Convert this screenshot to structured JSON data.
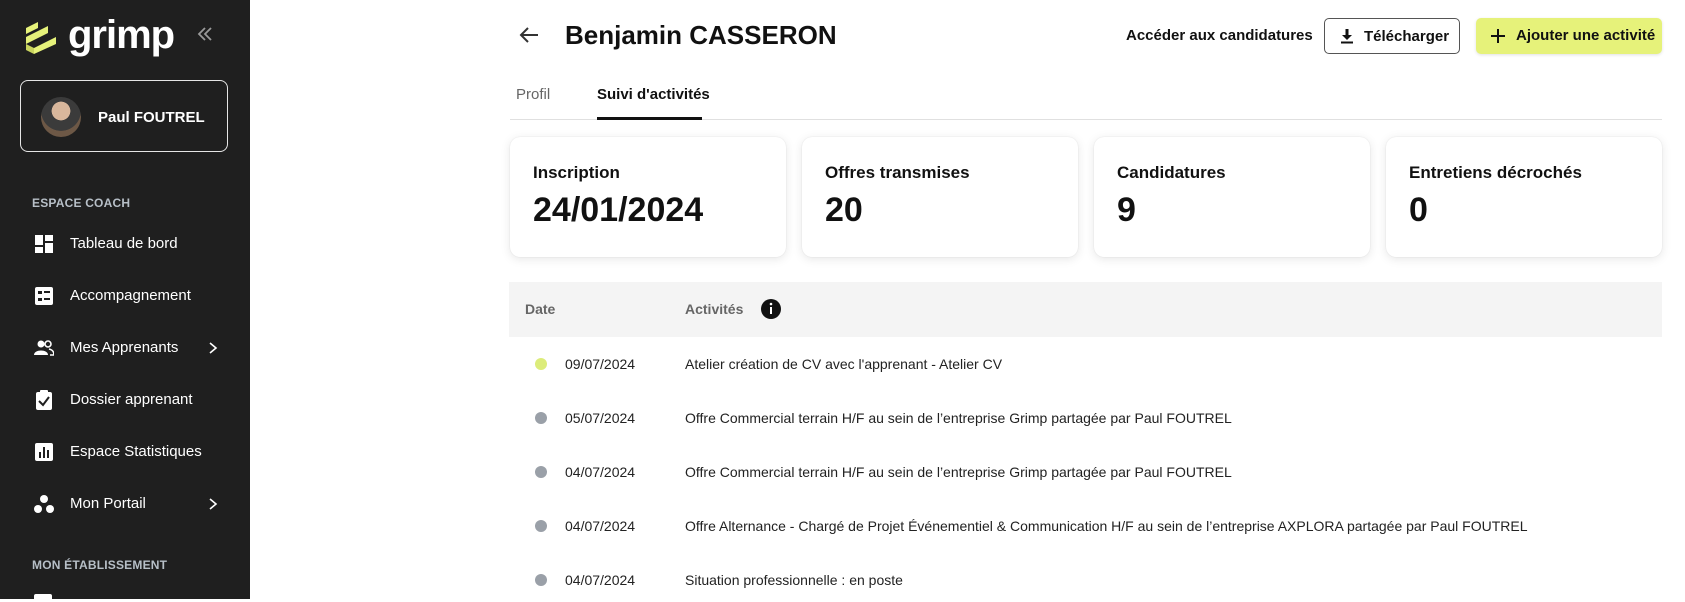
{
  "brand": {
    "name": "grimp",
    "accent": "#e6f27a",
    "sidebar_bg": "#1f1f1f"
  },
  "sidebar": {
    "user_name": "Paul FOUTREL",
    "section_coach": "ESPACE COACH",
    "items": [
      {
        "label": "Tableau de bord",
        "icon": "dashboard-icon",
        "chevron": false
      },
      {
        "label": "Accompagnement",
        "icon": "checklist-icon",
        "chevron": false
      },
      {
        "label": "Mes Apprenants",
        "icon": "people-icon",
        "chevron": true
      },
      {
        "label": "Dossier apprenant",
        "icon": "clipboard-check-icon",
        "chevron": false
      },
      {
        "label": "Espace Statistiques",
        "icon": "bar-chart-icon",
        "chevron": false
      },
      {
        "label": "Mon Portail",
        "icon": "portal-icon",
        "chevron": true
      }
    ],
    "section_etablissement": "MON ÉTABLISSEMENT"
  },
  "header": {
    "title": "Benjamin CASSERON",
    "link_candidatures": "Accéder aux candidatures",
    "download_label": "Télécharger",
    "add_label": "Ajouter une activité"
  },
  "tabs": [
    {
      "label": "Profil",
      "active": false
    },
    {
      "label": "Suivi d'activités",
      "active": true
    }
  ],
  "stats": [
    {
      "label": "Inscription",
      "value": "24/01/2024"
    },
    {
      "label": "Offres transmises",
      "value": "20"
    },
    {
      "label": "Candidatures",
      "value": "9"
    },
    {
      "label": "Entretiens décrochés",
      "value": "0"
    }
  ],
  "table": {
    "col_date": "Date",
    "col_activities": "Activités",
    "rows": [
      {
        "date": "09/07/2024",
        "activity": "Atelier création de CV avec l'apprenant - Atelier CV",
        "status_color": "#dcec7a"
      },
      {
        "date": "05/07/2024",
        "activity": "Offre Commercial terrain H/F au sein de l’entreprise Grimp partagée par Paul FOUTREL",
        "status_color": "#9aa0a8"
      },
      {
        "date": "04/07/2024",
        "activity": "Offre Commercial terrain H/F au sein de l’entreprise Grimp partagée par Paul FOUTREL",
        "status_color": "#9aa0a8"
      },
      {
        "date": "04/07/2024",
        "activity": "Offre Alternance - Chargé de Projet Événementiel & Communication H/F au sein de l’entreprise AXPLORA partagée par Paul FOUTREL",
        "status_color": "#9aa0a8"
      },
      {
        "date": "04/07/2024",
        "activity": "Situation professionnelle : en poste",
        "status_color": "#9aa0a8"
      }
    ]
  }
}
